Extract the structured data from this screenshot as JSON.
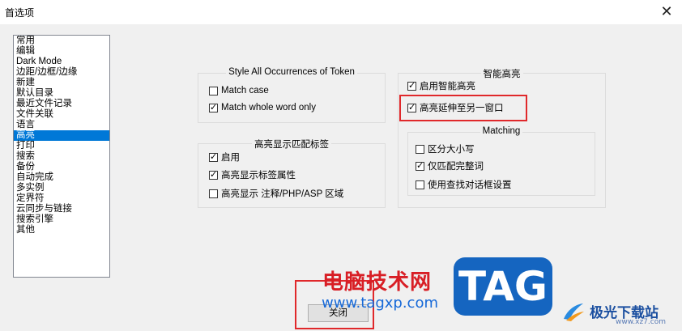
{
  "window": {
    "title": "首选项"
  },
  "categories": [
    {
      "label": "常用"
    },
    {
      "label": "编辑"
    },
    {
      "label": "Dark Mode"
    },
    {
      "label": "边距/边框/边缘"
    },
    {
      "label": "新建"
    },
    {
      "label": "默认目录"
    },
    {
      "label": "最近文件记录"
    },
    {
      "label": "文件关联"
    },
    {
      "label": "语言"
    },
    {
      "label": "高亮",
      "selected": true
    },
    {
      "label": "打印"
    },
    {
      "label": "搜索"
    },
    {
      "label": "备份"
    },
    {
      "label": "自动完成"
    },
    {
      "label": "多实例"
    },
    {
      "label": "定界符"
    },
    {
      "label": "云同步与链接"
    },
    {
      "label": "搜索引擎"
    },
    {
      "label": "其他"
    }
  ],
  "style_token": {
    "title": "Style All Occurrences of Token",
    "match_case": {
      "label": "Match case",
      "checked": false
    },
    "match_whole_word": {
      "label": "Match whole word only",
      "checked": true
    }
  },
  "tag_match": {
    "title": "高亮显示匹配标签",
    "enable": {
      "label": "启用",
      "checked": true
    },
    "highlight_attr": {
      "label": "高亮显示标签属性",
      "checked": true
    },
    "highlight_comment": {
      "label": "高亮显示 注释/PHP/ASP 区域",
      "checked": false
    }
  },
  "smart_highlight": {
    "title": "智能高亮",
    "enable": {
      "label": "启用智能高亮",
      "checked": true
    },
    "extend_other_view": {
      "label": "高亮延伸至另一窗口",
      "checked": true
    },
    "matching": {
      "title": "Matching",
      "match_case": {
        "label": "区分大小写",
        "checked": false
      },
      "whole_word": {
        "label": "仅匹配完整词",
        "checked": true
      },
      "use_find_settings": {
        "label": "使用查找对话框设置",
        "checked": false
      }
    }
  },
  "buttons": {
    "close": "关闭"
  },
  "watermark": {
    "site_name": "电脑技术网",
    "url": "www.tagxp.com",
    "tag": "TAG",
    "site_name2": "极光下载站",
    "url2": "www.xz7.com"
  },
  "colors": {
    "selection": "#0078d7",
    "annotation_red": "#e0282b",
    "watermark_blue": "#1565c0"
  }
}
